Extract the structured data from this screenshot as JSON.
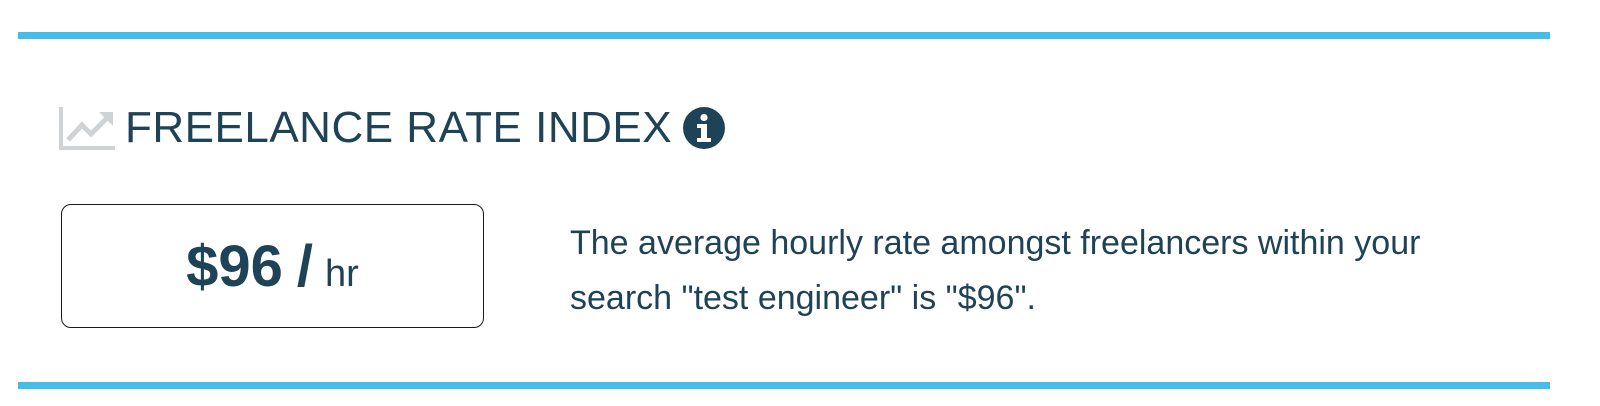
{
  "colors": {
    "accent_rule": "#45bde6",
    "text": "#1f4356",
    "icon_muted": "#cfd3d6",
    "box_border": "#1a1a1a"
  },
  "header": {
    "icon": "trend-chart-icon",
    "title": "FREELANCE RATE INDEX",
    "info_icon": "info-icon"
  },
  "rate": {
    "value": "$96",
    "separator": "/",
    "unit": "hr"
  },
  "description": {
    "text": "The average hourly rate amongst freelancers within your search \"test engineer\" is \"$96\"."
  }
}
